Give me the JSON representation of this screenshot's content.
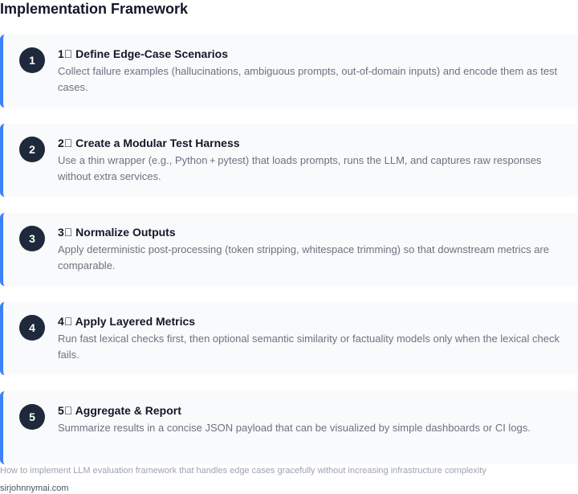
{
  "page": {
    "title": "Implementation Framework",
    "caption": "How to implement LLM evaluation framework that handles edge cases gracefully without increasing infrastructure complexity",
    "site": "sirjohnnymai.com"
  },
  "colors": {
    "accent": "#3b82f6",
    "badge": "#1e293b",
    "card_bg": "#f9fafb"
  },
  "steps": [
    {
      "number": "1",
      "title": "1⃣ Define Edge-Case Scenarios",
      "description": "Collect failure examples (hallucinations, ambiguous prompts, out-of-domain inputs) and encode them as test cases."
    },
    {
      "number": "2",
      "title": "2⃣ Create a Modular Test Harness",
      "description": "Use a thin wrapper (e.g., Python + pytest) that loads prompts, runs the LLM, and captures raw responses without extra services."
    },
    {
      "number": "3",
      "title": "3⃣ Normalize Outputs",
      "description": "Apply deterministic post-processing (token stripping, whitespace trimming) so that downstream metrics are comparable."
    },
    {
      "number": "4",
      "title": "4⃣ Apply Layered Metrics",
      "description": "Run fast lexical checks first, then optional semantic similarity or factuality models only when the lexical check fails."
    },
    {
      "number": "5",
      "title": "5⃣ Aggregate & Report",
      "description": "Summarize results in a concise JSON payload that can be visualized by simple dashboards or CI logs."
    }
  ]
}
